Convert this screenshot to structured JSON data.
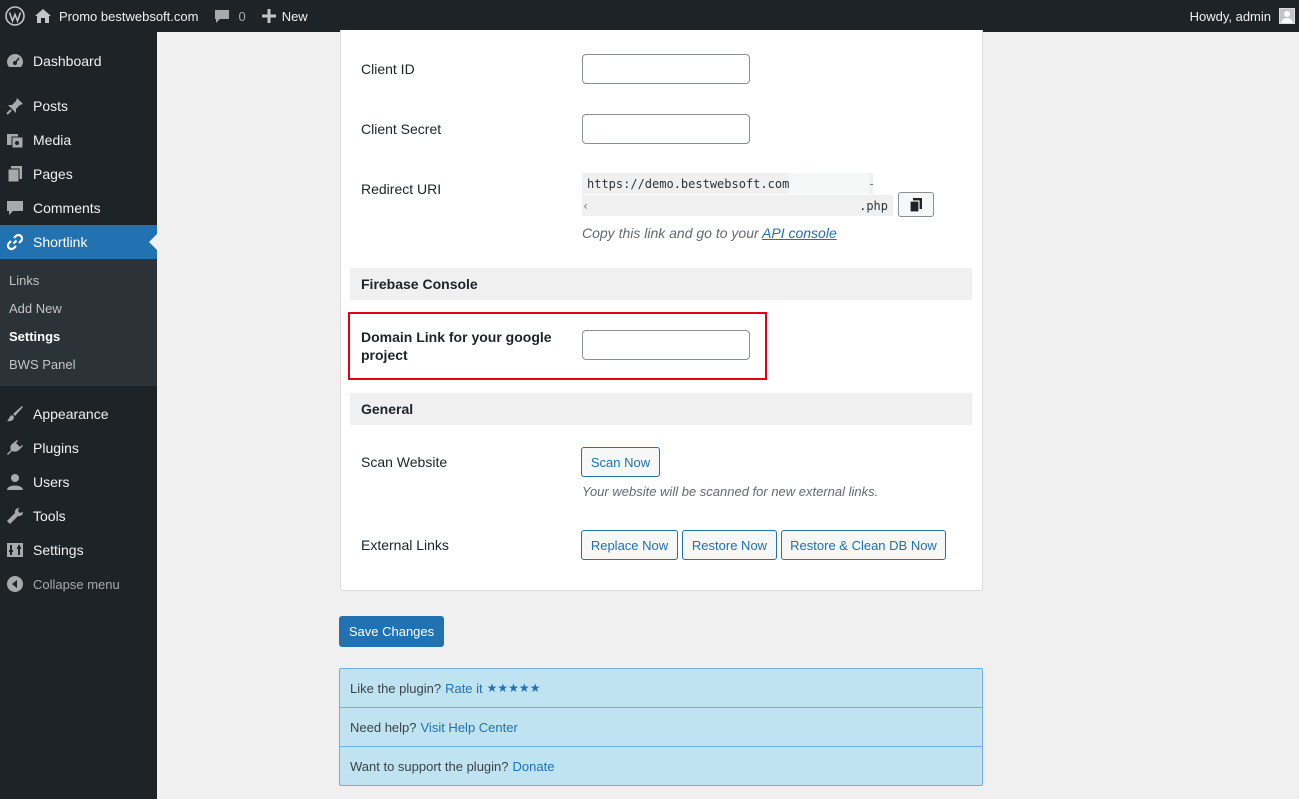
{
  "adminbar": {
    "site_name": "Promo bestwebsoft.com",
    "comments_count": "0",
    "new_label": "New",
    "howdy": "Howdy, admin"
  },
  "sidebar": {
    "items": [
      {
        "label": "Dashboard",
        "icon": "dashboard-icon"
      },
      {
        "label": "Posts",
        "icon": "pin-icon"
      },
      {
        "label": "Media",
        "icon": "media-icon"
      },
      {
        "label": "Pages",
        "icon": "pages-icon"
      },
      {
        "label": "Comments",
        "icon": "comment-icon"
      },
      {
        "label": "Shortlink",
        "icon": "link-icon"
      },
      {
        "label": "Appearance",
        "icon": "brush-icon"
      },
      {
        "label": "Plugins",
        "icon": "plugin-icon"
      },
      {
        "label": "Users",
        "icon": "user-icon"
      },
      {
        "label": "Tools",
        "icon": "wrench-icon"
      },
      {
        "label": "Settings",
        "icon": "settings-icon"
      }
    ],
    "submenu": [
      "Links",
      "Add New",
      "Settings",
      "BWS Panel"
    ],
    "collapse_label": "Collapse menu"
  },
  "form": {
    "client_id_label": "Client ID",
    "client_id_value": "",
    "client_secret_label": "Client Secret",
    "client_secret_value": "",
    "redirect_uri_label": "Redirect URI",
    "redirect_uri_start": "https://demo.bestwebsoft.com",
    "redirect_uri_end": ".php",
    "redirect_desc": "Copy this link and go to your",
    "api_console_link": "API console",
    "firebase_heading": "Firebase Console",
    "domain_link_label": "Domain Link for your google project",
    "domain_link_value": "",
    "general_heading": "General",
    "scan_label": "Scan Website",
    "scan_button": "Scan Now",
    "scan_desc": "Your website will be scanned for new external links.",
    "external_label": "External Links",
    "replace_button": "Replace Now",
    "restore_button": "Restore Now",
    "restore_clean_button": "Restore & Clean DB Now"
  },
  "save_button": "Save Changes",
  "info": {
    "like_text": "Like the plugin?",
    "rate_link": "Rate it",
    "stars": "★★★★★",
    "help_text": "Need help?",
    "help_link": "Visit Help Center",
    "support_text": "Want to support the plugin?",
    "donate_link": "Donate"
  },
  "colors": {
    "admin_bg": "#1d2327",
    "accent": "#2271b1",
    "highlight_border": "#e3000f",
    "info_bg": "#bfe3f1"
  }
}
